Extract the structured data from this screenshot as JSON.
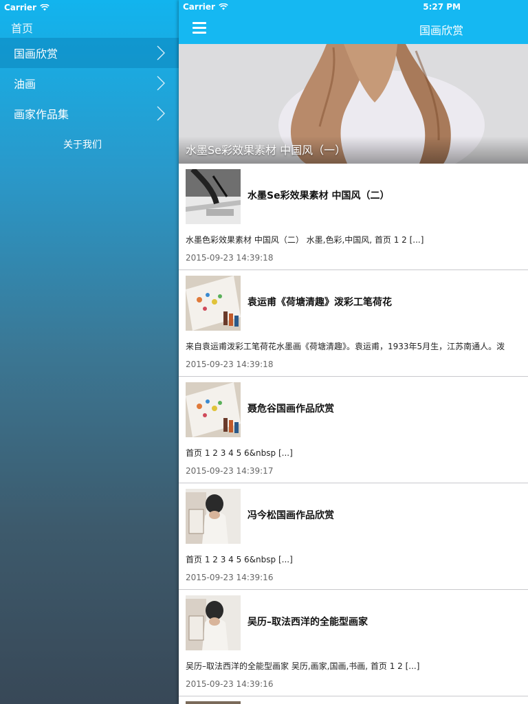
{
  "status": {
    "carrier": "Carrier",
    "time": "5:27 PM"
  },
  "sidebar": {
    "title": "首页",
    "items": [
      {
        "label": "国画欣赏"
      },
      {
        "label": "油画"
      },
      {
        "label": "画家作品集"
      }
    ],
    "about": "关于我们"
  },
  "navbar": {
    "title": "国画欣赏"
  },
  "hero": {
    "caption": "水墨Se彩效果素材 中国风（一）"
  },
  "articles": [
    {
      "title": "水墨Se彩效果素材 中国风（二）",
      "excerpt": "水墨色彩效果素材 中国风（二） 水墨,色彩,中国风, 首页 1 2 [...]",
      "date": "2015-09-23 14:39:18"
    },
    {
      "title": "袁运甫《荷塘清趣》泼彩工笔荷花",
      "excerpt": "来自袁运甫泼彩工笔荷花水墨画《荷塘清趣》。袁运甫，1933年5月生，江苏南通人。泼",
      "date": "2015-09-23 14:39:18"
    },
    {
      "title": "聂危谷国画作品欣赏",
      "excerpt": "首页 1 2 3 4 5 6&nbsp [...]",
      "date": "2015-09-23 14:39:17"
    },
    {
      "title": "冯今松国画作品欣赏",
      "excerpt": "首页 1 2 3 4 5 6&nbsp [...]",
      "date": "2015-09-23 14:39:16"
    },
    {
      "title": "吴历–取法西洋的全能型画家",
      "excerpt": "吴历–取法西洋的全能型画家 吴历,画家,国画,书画, 首页 1 2 [...]",
      "date": "2015-09-23 14:39:16"
    }
  ],
  "colors": {
    "nav": "#15b8f2",
    "sidebar_top": "#12b4ee",
    "sidebar_bottom": "#384857"
  }
}
